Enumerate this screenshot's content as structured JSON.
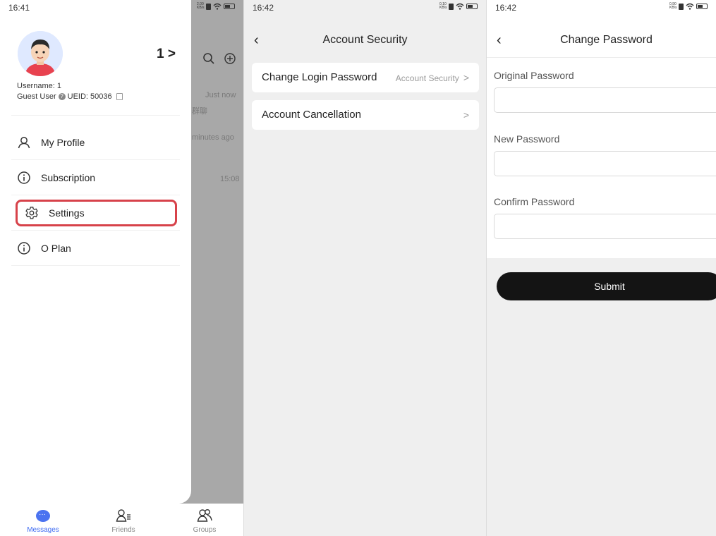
{
  "screen1": {
    "status_time": "16:41",
    "status_speed": "2.00 KB/s",
    "profile_number": "1",
    "username": "Username: 1",
    "guest_user": "Guest User",
    "ueid": "UEID: 50036",
    "menu": [
      {
        "label": "My Profile",
        "icon": "person-icon"
      },
      {
        "label": "Subscription",
        "icon": "info-icon"
      },
      {
        "label": "Settings",
        "icon": "gear-icon"
      },
      {
        "label": "O Plan",
        "icon": "info-icon"
      }
    ],
    "background_list": {
      "just_now": "Just now",
      "group_chat": "群聊",
      "minutes_ago": "minutes ago",
      "time": "15:08"
    },
    "tabs": [
      {
        "label": "Messages",
        "active": true
      },
      {
        "label": "Friends",
        "active": false
      },
      {
        "label": "Groups",
        "active": false
      }
    ],
    "highlight_color": "#d7424a"
  },
  "screen2": {
    "status_time": "16:42",
    "status_speed": "0.10 KB/s",
    "title": "Account Security",
    "items": [
      {
        "label": "Change Login Password",
        "right_text": "Account Security"
      },
      {
        "label": "Account Cancellation",
        "right_text": ""
      }
    ]
  },
  "screen3": {
    "status_time": "16:42",
    "status_speed": "0.90 KB/s",
    "title": "Change Password",
    "fields": [
      {
        "label": "Original Password",
        "value": ""
      },
      {
        "label": "New Password",
        "value": ""
      },
      {
        "label": "Confirm Password",
        "value": ""
      }
    ],
    "submit_label": "Submit"
  }
}
